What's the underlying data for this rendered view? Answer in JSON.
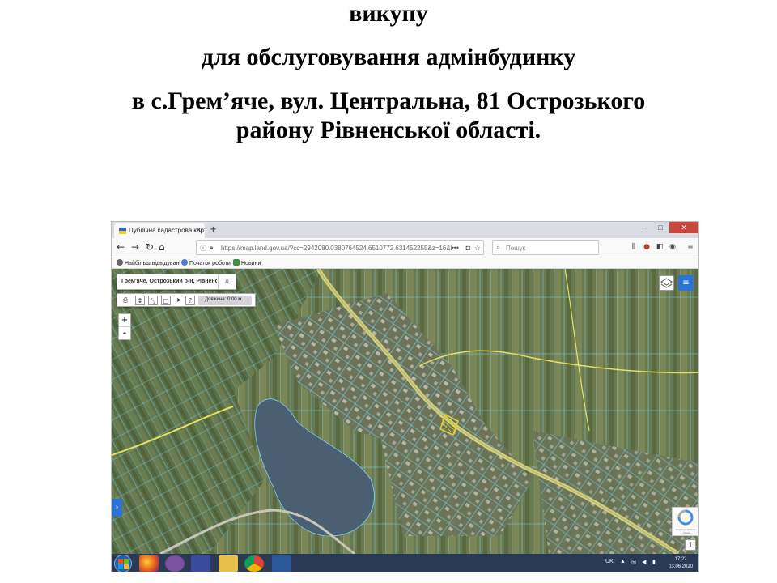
{
  "heading": {
    "line1": "викупу",
    "line2": "для обслуговування адмінбудинку",
    "line3": "в с.Грем’яче, вул. Центральна, 81 Острозького",
    "line4": "району Рівненської області."
  },
  "browser": {
    "tab_title": "Публічна кадастрова карта Ук",
    "new_tab": "+",
    "url": "https://map.land.gov.ua/?cc=2942080.0380764524.6510772.631452255&z=16&l=",
    "search_placeholder": "Пошук",
    "bookmarks": [
      "Найбільш відвідувані",
      "Початок роботи",
      "Новини"
    ],
    "window_controls": [
      "–",
      "□",
      "✕"
    ]
  },
  "map": {
    "search_value": "Грем'яче, Острозький р-н, Рівненська обл",
    "measure_label": "Довжина: 0.00 м",
    "zoom_in": "+",
    "zoom_out": "-",
    "recaptcha_text": "Конфіденційність - Умови",
    "info": "i",
    "colors": {
      "parcel_outline": "#7ad0f0",
      "road": "#e8e060",
      "highlight_parcel": "#f0d020",
      "water": "#4b5f73"
    }
  },
  "taskbar": {
    "language": "UK",
    "time": "17:22",
    "date": "03.06.2020"
  }
}
